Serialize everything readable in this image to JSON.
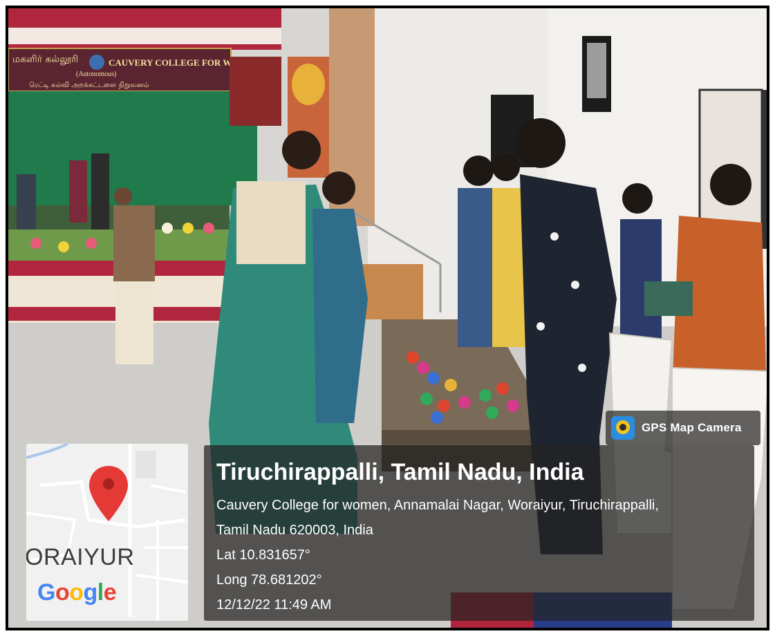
{
  "banner": {
    "tamil_left": "மகளிர் கல்லூரி",
    "college": "CAUVERY COLLEGE FOR WOMEN",
    "autonomous": "(Autonomous)",
    "tamil_sub": "ரெட்டி கல்வி அறக்கட்டளை நிறுவனம்"
  },
  "badge": {
    "icon": "gps-map-camera-icon",
    "label": "GPS Map Camera"
  },
  "map": {
    "place": "ORAIYUR",
    "logo": [
      "G",
      "o",
      "o",
      "g",
      "l",
      "e"
    ],
    "pin_color": "#E53935"
  },
  "info": {
    "title": "Tiruchirappalli, Tamil Nadu, India",
    "address_line1": "Cauvery College for women, Annamalai Nagar, Woraiyur, Tiruchirappalli,",
    "address_line2": "Tamil Nadu 620003, India",
    "lat": "Lat 10.831657°",
    "long": "Long 78.681202°",
    "datetime": "12/12/22 11:49 AM"
  }
}
